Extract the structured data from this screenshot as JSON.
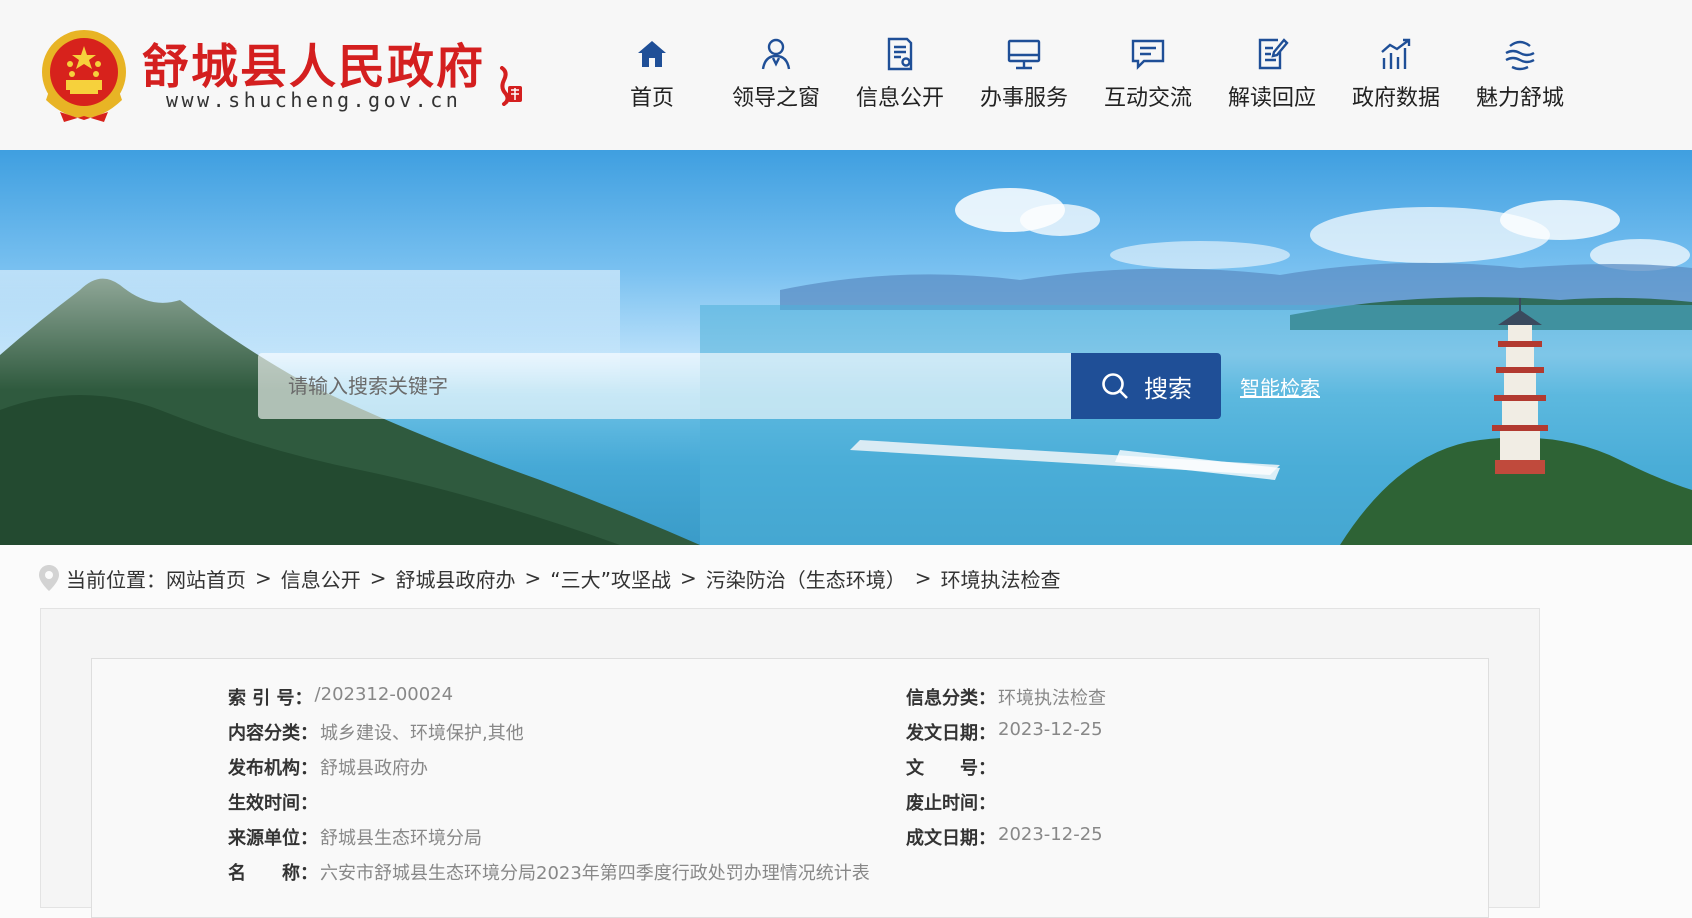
{
  "header": {
    "site_title": "舒城县人民政府",
    "site_url": "www.shucheng.gov.cn",
    "nav": [
      {
        "label": "首页",
        "icon": "home-icon"
      },
      {
        "label": "领导之窗",
        "icon": "leader-icon"
      },
      {
        "label": "信息公开",
        "icon": "document-icon"
      },
      {
        "label": "办事服务",
        "icon": "monitor-icon"
      },
      {
        "label": "互动交流",
        "icon": "chat-icon"
      },
      {
        "label": "解读回应",
        "icon": "edit-doc-icon"
      },
      {
        "label": "政府数据",
        "icon": "chart-icon"
      },
      {
        "label": "魅力舒城",
        "icon": "landscape-icon"
      }
    ]
  },
  "search": {
    "placeholder": "请输入搜索关键字",
    "button_label": "搜索",
    "smart_link": "智能检索"
  },
  "breadcrumb": {
    "prefix": "当前位置：",
    "items": [
      "网站首页",
      "信息公开",
      "舒城县政府办",
      "“三大”攻坚战",
      "污染防治（生态环境）",
      "环境执法检查"
    ],
    "separator": ">"
  },
  "meta": {
    "index_no": {
      "label": "索 引 号：",
      "value": "/202312-00024"
    },
    "info_category": {
      "label": "信息分类：",
      "value": "环境执法检查"
    },
    "content_category": {
      "label": "内容分类：",
      "value": "城乡建设、环境保护,其他"
    },
    "issue_date": {
      "label": "发文日期：",
      "value": "2023-12-25"
    },
    "publisher": {
      "label": "发布机构：",
      "value": "舒城县政府办"
    },
    "doc_no": {
      "label": "文　　号：",
      "value": ""
    },
    "effective_time": {
      "label": "生效时间：",
      "value": ""
    },
    "expiry_time": {
      "label": "废止时间：",
      "value": ""
    },
    "source": {
      "label": "来源单位：",
      "value": "舒城县生态环境分局"
    },
    "created_date": {
      "label": "成文日期：",
      "value": "2023-12-25"
    },
    "name": {
      "label": "名　　称：",
      "value": "六安市舒城县生态环境分局2023年第四季度行政处罚办理情况统计表"
    }
  },
  "colors": {
    "brand_red": "#d41f1f",
    "nav_blue": "#1f4f97"
  }
}
